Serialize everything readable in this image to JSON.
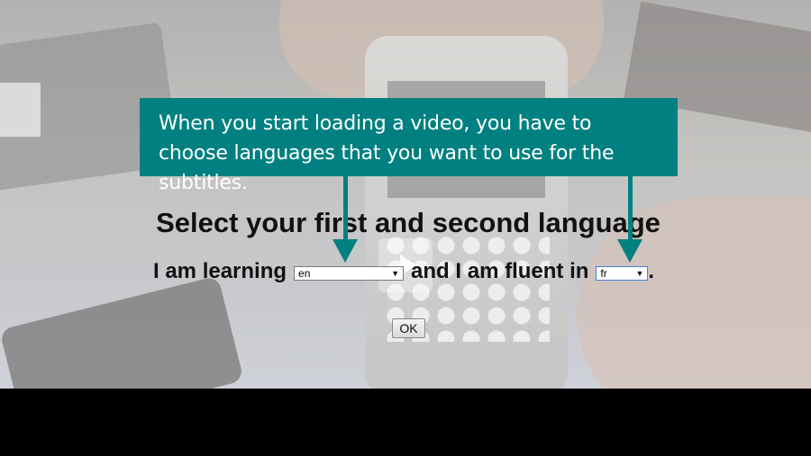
{
  "callout": {
    "text": "When you start loading a video, you have to choose languages that you want to use for the subtitles."
  },
  "form": {
    "heading": "Select your first and second language",
    "learning_label": "I am learning",
    "first_language": "en",
    "fluent_label": "and I am fluent in",
    "second_language": "fr",
    "end_punct": ".",
    "ok_label": "OK"
  },
  "colors": {
    "callout_bg": "#008080",
    "callout_text": "#ffffff",
    "letterbox": "#000000"
  },
  "icons": {
    "dropdown": "caret-down-icon",
    "callout_arrows": "arrow-down-icon"
  }
}
